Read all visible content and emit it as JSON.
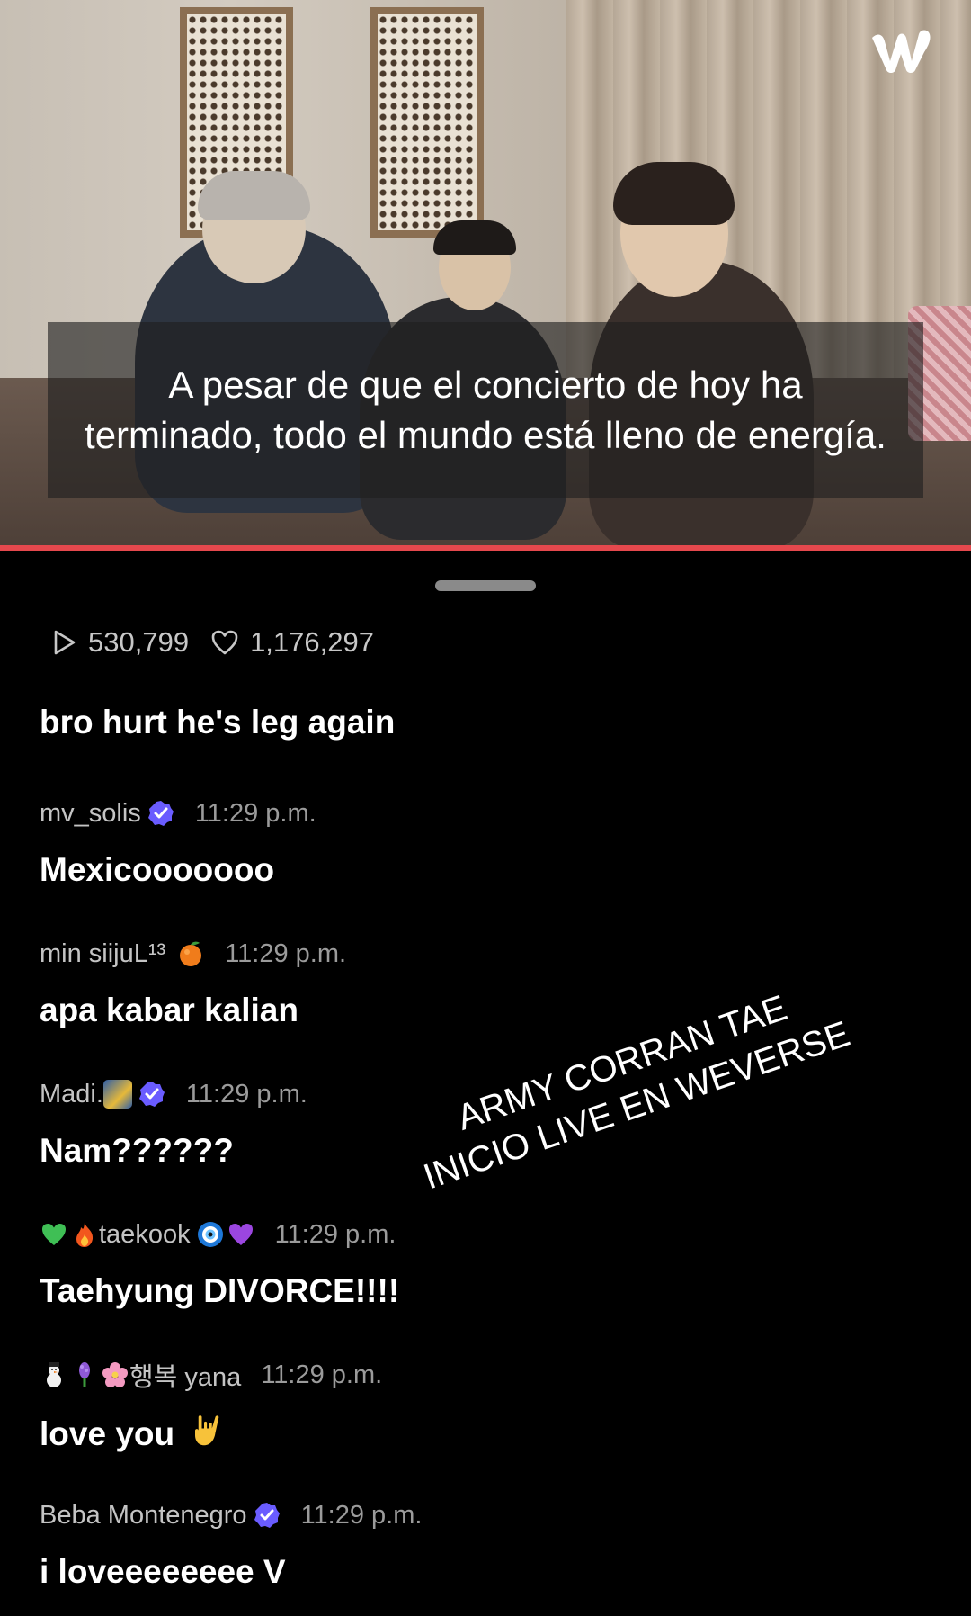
{
  "video": {
    "subtitle": "A pesar de que el concierto de hoy ha terminado, todo el mundo está lleno de energía.",
    "brand_logo_text": "w",
    "progress_color": "#e5484d"
  },
  "stats": {
    "views": "530,799",
    "likes": "1,176,297"
  },
  "first_message": "bro hurt he's leg again",
  "comments": [
    {
      "user": "mv_solis",
      "time": "11:29 p.m.",
      "message": "Mexicooooooo"
    },
    {
      "user": "min siijuL¹³",
      "time": "11:29 p.m.",
      "message": "apa kabar kalian"
    },
    {
      "user": "Madi.",
      "time": "11:29 p.m.",
      "message": "Nam??????"
    },
    {
      "user": "taekook",
      "time": "11:29 p.m.",
      "message": "Taehyung DIVORCE!!!!"
    },
    {
      "user": "행복 yana",
      "time": "11:29 p.m.",
      "message": "love you"
    },
    {
      "user": "Beba Montenegro",
      "time": "11:29 p.m.",
      "message": "i loveeeeeeee V"
    }
  ],
  "overlay": {
    "line1": "ARMY CORRAN TAE",
    "line2": "INICIO LIVE EN WEVERSE"
  },
  "colors": {
    "verified_badge": "#6a5cff",
    "background": "#000000"
  }
}
